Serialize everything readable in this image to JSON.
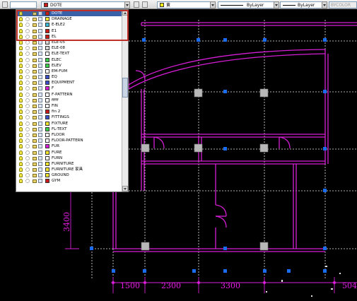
{
  "toolbar": {
    "layer_current": "DOTE",
    "color_chip": "#f5f019",
    "color_label": "黄",
    "linetype_label": "ByLayer",
    "lineweight_label": "ByLayer",
    "plotstyle_label": "BYCOLOR"
  },
  "layers": [
    {
      "name": "DOTE",
      "color": "#cc1a1a",
      "selected": true
    },
    {
      "name": "DRAINAGE",
      "color": "#f2e530"
    },
    {
      "name": "E-ELE2",
      "color": "#3abcd6"
    },
    {
      "name": "E1",
      "color": "#cc1a1a"
    },
    {
      "name": "EL",
      "color": "#cc1a1a"
    },
    {
      "name": "ELE-05",
      "color": "#d8d8d8"
    },
    {
      "name": "ELE-08",
      "color": "#d8d8d8"
    },
    {
      "name": "ELE-TEXT",
      "color": "#ffffff"
    },
    {
      "name": "ELEC",
      "color": "#3bd14a"
    },
    {
      "name": "ELEV",
      "color": "#3bd14a"
    },
    {
      "name": "EM-FUM",
      "color": "#ffffff"
    },
    {
      "name": "EQ",
      "color": "#3a4fc8"
    },
    {
      "name": "EQUIPMENT",
      "color": "#3a4fc8"
    },
    {
      "name": "F",
      "color": "#d61ed6"
    },
    {
      "name": "F-PATTERN",
      "color": "#ffffff"
    },
    {
      "name": "fffff",
      "color": "#ffffff"
    },
    {
      "name": "FIN",
      "color": "#ffffff"
    },
    {
      "name": "fin 2",
      "color": "#cc1a1a"
    },
    {
      "name": "FITTINGS",
      "color": "#3a4fc8"
    },
    {
      "name": "FIXTURE",
      "color": "#f2e530"
    },
    {
      "name": "FL-TEXT",
      "color": "#3bd14a"
    },
    {
      "name": "FLOOR",
      "color": "#ffffff"
    },
    {
      "name": "FLOOR-PATTERN",
      "color": "#ffffff"
    },
    {
      "name": "FUR",
      "color": "#d61ed6"
    },
    {
      "name": "FURE",
      "color": "#f2e530"
    },
    {
      "name": "FURN",
      "color": "#ffffff"
    },
    {
      "name": "FURNITURE",
      "color": "#f2e530"
    },
    {
      "name": "FURNITURE 家具",
      "color": "#f2e530"
    },
    {
      "name": "GROUND",
      "color": "#f2e530"
    },
    {
      "name": "GYM",
      "color": "#cc1a1a"
    }
  ],
  "dimensions": {
    "d1500": "1500",
    "d2300": "2300",
    "d3300": "3300",
    "d504": "504",
    "d3400": "3400"
  },
  "colors": {
    "wall": "#d61ed6",
    "grid": "#ffffff",
    "node": "#1a6cf0",
    "highlight": "#c0302b"
  }
}
